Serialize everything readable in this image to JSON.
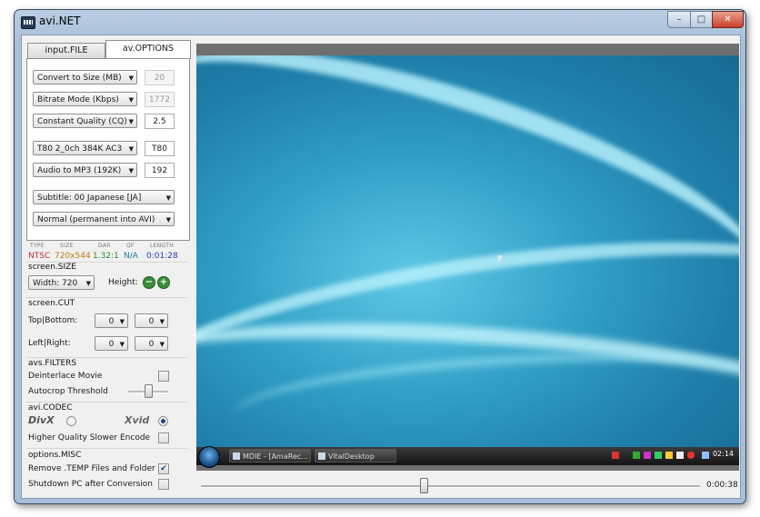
{
  "window": {
    "title": "avi.NET",
    "min": "–",
    "max": "□",
    "close": "✕"
  },
  "tabs": {
    "file": "input.FILE",
    "options": "av.OPTIONS"
  },
  "options": {
    "convert_mode": "Convert to Size (MB)",
    "convert_value": "20",
    "bitrate_mode": "Bitrate Mode (Kbps)",
    "bitrate_value": "1772",
    "quality_mode": "Constant Quality (CQ)",
    "quality_value": "2.5",
    "audio_track": "T80 2_0ch 384K AC3",
    "audio_track_value": "T80",
    "audio_conv": "Audio to MP3 (192K)",
    "audio_conv_value": "192",
    "subtitle": "Subtitle: 00 Japanese [JA]",
    "subtitle_mode": "Normal (permanent into AVI)"
  },
  "info": {
    "headers": [
      "TYPE",
      "SIZE",
      "DAR",
      "QF",
      "LENGTH"
    ],
    "values": [
      "NTSC",
      "720x544",
      "1.32:1",
      "N/A",
      "0:01:28"
    ],
    "colors": [
      "#c03030",
      "#c07a10",
      "#2a8a2a",
      "#1a7a9a",
      "#1f3fbf"
    ]
  },
  "screen_size": {
    "heading": "screen.SIZE",
    "width": "Width: 720",
    "height_label": "Height:",
    "minus": "−",
    "plus": "+"
  },
  "screen_cut": {
    "heading": "screen.CUT",
    "tb_label": "Top|Bottom:",
    "lr_label": "Left|Right:",
    "top": "0",
    "bottom": "0",
    "left": "0",
    "right": "0"
  },
  "filters": {
    "heading": "avs.FILTERS",
    "deinterlace": "Deinterlace Movie",
    "autocrop": "Autocrop Threshold"
  },
  "codec": {
    "heading": "avi.CODEC",
    "divx": "DivX",
    "xvid": "Xvid",
    "hq": "Higher Quality Slower Encode",
    "selected": "xvid"
  },
  "misc": {
    "heading": "options.MISC",
    "remove_temp": "Remove .TEMP Files and Folder",
    "remove_temp_checked": "✔",
    "shutdown": "Shutdown PC after Conversion"
  },
  "preview": {
    "taskbar": {
      "task1": "MDIE - [AmaRec...",
      "task2": "VitalDesktop",
      "clock": "02:14"
    }
  },
  "player": {
    "time": "0:00:38"
  }
}
